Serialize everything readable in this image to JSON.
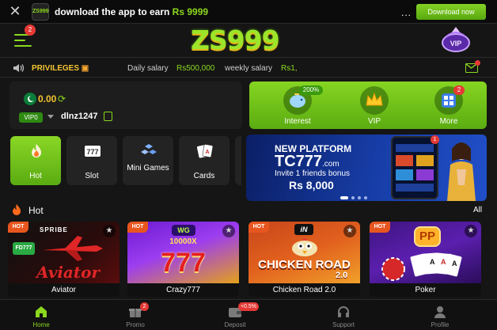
{
  "banner": {
    "app_logo_text": "ZS999",
    "text_prefix": "download the app to earn ",
    "text_amount": "Rs 9999",
    "dots": "...",
    "download_label": "Download now"
  },
  "header": {
    "menu_badge": "2",
    "logo_text": "ZS999",
    "vip_emblem_text": "VIP"
  },
  "salary_bar": {
    "privileges_label": "PRIVILEGES",
    "daily_label": "Daily salary",
    "daily_value": "Rs500,000",
    "weekly_label": "weekly salary",
    "weekly_value": "Rs1,"
  },
  "wallet": {
    "balance": "0.00",
    "vip_level": "VIP0",
    "username": "dlnz1247"
  },
  "actions": [
    {
      "label": "Interest",
      "icon": "piggy-bank-icon",
      "badge": "200%"
    },
    {
      "label": "VIP",
      "icon": "crown-icon",
      "badge": ""
    },
    {
      "label": "More",
      "icon": "apps-grid-icon",
      "badge": "2"
    }
  ],
  "categories": [
    {
      "label": "Hot",
      "icon": "flame-icon",
      "active": true
    },
    {
      "label": "Slot",
      "icon": "slot-777-icon",
      "active": false
    },
    {
      "label": "Mini Games",
      "icon": "mini-games-icon",
      "active": false
    },
    {
      "label": "Cards",
      "icon": "cards-icon",
      "active": false
    }
  ],
  "promo": {
    "line1": "NEW PLATFORM",
    "line2": "TC777",
    "line2_suffix": ".com",
    "line3": "Invite 1 friends bonus",
    "line4": "Rs 8,000",
    "phone_badge": "1"
  },
  "hot_section": {
    "title": "Hot",
    "all_label": "All",
    "games": [
      {
        "name": "Aviator",
        "badge": "HOT",
        "art_text": "Aviator",
        "provider": "SPRIBE",
        "sub": "FD777"
      },
      {
        "name": "Crazy777",
        "badge": "HOT",
        "art_text": "777",
        "provider": "WG",
        "sub": "10000X"
      },
      {
        "name": "Chicken Road 2.0",
        "badge": "HOT",
        "art_text": "CHICKEN ROAD",
        "provider": "iN",
        "sub": "2.0"
      },
      {
        "name": "Poker",
        "badge": "HOT",
        "art_text": "PP",
        "provider": "",
        "sub": ""
      }
    ]
  },
  "bottom_nav": [
    {
      "label": "Home",
      "icon": "home-icon",
      "badge": "",
      "active": true
    },
    {
      "label": "Promo",
      "icon": "gift-icon",
      "badge": "2",
      "active": false
    },
    {
      "label": "Deposit",
      "icon": "wallet-icon",
      "badge": "+0.5%",
      "active": false
    },
    {
      "label": "Support",
      "icon": "headset-icon",
      "badge": "",
      "active": false
    },
    {
      "label": "Profile",
      "icon": "person-icon",
      "badge": "",
      "active": false
    }
  ],
  "colors": {
    "accent_green": "#8bd81e",
    "gold": "#f4c430",
    "hot_badge": "#e8561f",
    "background": "#151515"
  }
}
